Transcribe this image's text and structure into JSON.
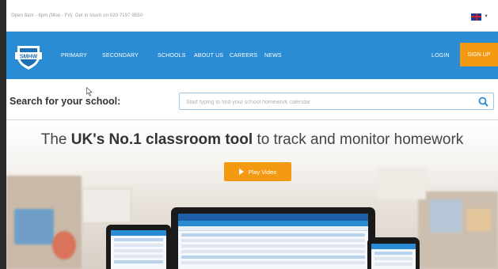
{
  "topbar": {
    "info": "Open 8am - 6pm (Mon - Fri). Get in touch on 020 7197 9550",
    "language_flag": "uk-flag-icon"
  },
  "nav": {
    "logo": "SMHW",
    "links": [
      "PRIMARY",
      "SECONDARY",
      "SCHOOLS",
      "ABOUT US",
      "CAREERS",
      "NEWS"
    ],
    "login": "LOGIN",
    "signup": "SIGN UP"
  },
  "search": {
    "label": "Search for your school:",
    "placeholder": "Start typing to find your school homework calendar",
    "icon": "search-icon"
  },
  "hero": {
    "title_pre": "The",
    "title_bold": "UK's No.1 classroom tool",
    "title_post": "to track and monitor homework",
    "play_label": "Play Video"
  },
  "colors": {
    "nav_blue": "#2a8cd4",
    "accent_orange": "#f39a12"
  }
}
